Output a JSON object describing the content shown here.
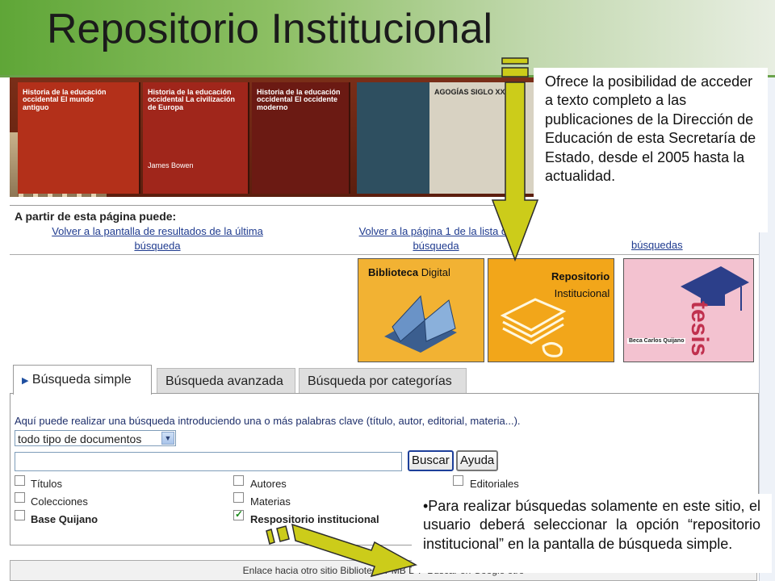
{
  "slide": {
    "title": "Repositorio Institucional",
    "callout_top": "Ofrece la posibilidad de acceder a texto completo a las publicaciones de la Dirección de Educación de esta Secretaría de Estado, desde el 2005 hasta la actualidad.",
    "callout_bottom": "•Para realizar búsquedas solamente en este sitio, el usuario deberá seleccionar la opción “repositorio institucional” en la pantalla de búsqueda simple."
  },
  "colors": {
    "accent_green": "#5fa637",
    "arrow_fill": "#cccc1a",
    "arrow_stroke": "#2b2b2b",
    "link": "#1f3b8f"
  },
  "banner": {
    "books": [
      {
        "title": "Historia de la educación occidental  El mundo antiguo"
      },
      {
        "title": "Historia de la educación occidental  La civilización de Europa"
      },
      {
        "title": "Historia de la educación occidental  El occidente moderno"
      },
      {
        "title": "AGOGÍAS SIGLO XX"
      }
    ],
    "author": "James Bowen"
  },
  "info": {
    "heading": "A partir de esta página puede:",
    "link1_line1": "Volver a la pantalla de resultados de la última",
    "link1_line2": "búsqueda",
    "link2_line1": "Volver a la página 1 de la lista de",
    "link2_line2": "búsqueda",
    "link3": "búsquedas"
  },
  "tiles": {
    "biblioteca": {
      "label": "Biblioteca",
      "sub": "Digital"
    },
    "repositorio": {
      "label": "Repositorio",
      "sub": "Institucional"
    },
    "tesis": {
      "caption": "Beca Carlos Quijano",
      "word": "tesis"
    }
  },
  "tabs": [
    {
      "label": "Búsqueda simple",
      "active": true
    },
    {
      "label": "Búsqueda avanzada",
      "active": false
    },
    {
      "label": "Búsqueda por categorías",
      "active": false
    }
  ],
  "search": {
    "instructions": "Aquí puede realizar una búsqueda introduciendo una o más palabras clave (título, autor, editorial, materia...).",
    "doc_type": "todo tipo de documentos",
    "buscar": "Buscar",
    "ayuda": "Ayuda",
    "options": [
      {
        "label": "Títulos",
        "checked": false
      },
      {
        "label": "Colecciones",
        "checked": false
      },
      {
        "label": "Base Quijano",
        "checked": false
      },
      {
        "label": "Autores",
        "checked": false
      },
      {
        "label": "Materias",
        "checked": false
      },
      {
        "label": "Respositorio institucional",
        "checked": true
      },
      {
        "label": "Editoriales",
        "checked": false
      }
    ]
  },
  "footer_bar": "Enlace hacia otro sitio   Biblioteca PMB D  P    Buscar en Google    otro"
}
